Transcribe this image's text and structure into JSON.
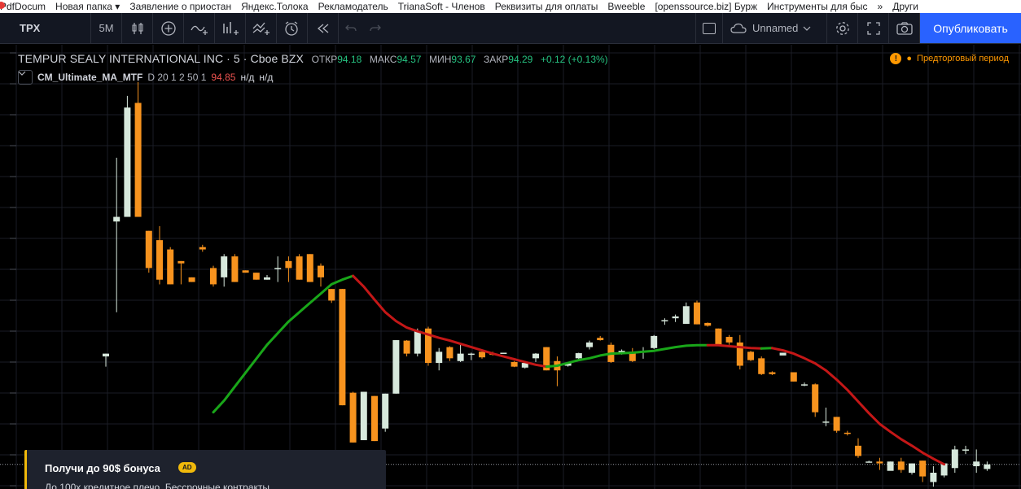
{
  "bookmarks": [
    "PdfDocum",
    "Новая папка ▾",
    "Заявление о приостан",
    "Яндекс.Толока",
    "Рекламодатель",
    "TrianaSoft - Членов",
    "Реквизиты для оплаты",
    "Bweeble",
    "[openssource.biz] Бурж",
    "Инструменты для быс",
    "»",
    "Други"
  ],
  "toolbar": {
    "symbol": "TPX",
    "interval": "5M",
    "icons": [
      "candles-icon",
      "plus-circle-icon",
      "indicator-icon",
      "templates-icon",
      "compare-icon",
      "alert-icon",
      "replay-icon",
      "undo-icon",
      "redo-icon"
    ],
    "layout_name": "Unnamed",
    "publish_label": "Опубликовать"
  },
  "legend": {
    "title": "TEMPUR SEALY INTERNATIONAL INC · 5 · Cboe BZX",
    "open_label": "ОТКР",
    "open": "94.18",
    "high_label": "МАКС",
    "high": "94.57",
    "low_label": "МИН",
    "low": "93.67",
    "close_label": "ЗАКР",
    "close": "94.29",
    "change": "+0.12 (+0.13%)"
  },
  "indicator": {
    "name": "CM_Ultimate_MA_MTF",
    "params": "D 20 1 2 50 1",
    "value": "94.85",
    "na1": "н/д",
    "na2": "н/д"
  },
  "market_status": {
    "label": "Предторговый период",
    "color": "#ff9800"
  },
  "promo": {
    "title": "Получи до 90$ бонуса",
    "badge": "AD",
    "body": "До 100х кредитное плечо. Бессрочные контракты"
  },
  "colors": {
    "up": "#d7e8dc",
    "down": "#f7931e",
    "ma_up": "#19a619",
    "ma_down": "#c41717",
    "accent": "#2962ff"
  },
  "chart_data": {
    "type": "candlestick",
    "interval": "5",
    "candles": [
      {
        "open": 94.4,
        "high": 94.46,
        "low": 94.18,
        "close": 94.46
      },
      {
        "open": 97.3,
        "high": 98.67,
        "low": 95.35,
        "close": 97.4
      },
      {
        "open": 97.4,
        "high": 100.0,
        "low": 97.4,
        "close": 99.75
      },
      {
        "open": 99.85,
        "high": 100.3,
        "low": 97.4,
        "close": 97.4
      },
      {
        "open": 97.1,
        "high": 97.1,
        "low": 96.2,
        "close": 96.3
      },
      {
        "open": 96.9,
        "high": 97.2,
        "low": 95.95,
        "close": 96.05
      },
      {
        "open": 96.7,
        "high": 96.75,
        "low": 95.95,
        "close": 95.95
      },
      {
        "open": 96.45,
        "high": 96.45,
        "low": 95.95,
        "close": 96.4
      },
      {
        "open": 96.1,
        "high": 96.1,
        "low": 96.0,
        "close": 96.0
      },
      {
        "open": 96.75,
        "high": 96.8,
        "low": 96.65,
        "close": 96.7
      },
      {
        "open": 96.3,
        "high": 96.35,
        "low": 95.9,
        "close": 95.95
      },
      {
        "open": 96.1,
        "high": 96.6,
        "low": 95.9,
        "close": 96.55
      },
      {
        "open": 96.55,
        "high": 96.6,
        "low": 96.0,
        "close": 96.0
      },
      {
        "open": 96.25,
        "high": 96.25,
        "low": 96.2,
        "close": 96.2
      },
      {
        "open": 96.2,
        "high": 96.2,
        "low": 96.05,
        "close": 96.05
      },
      {
        "open": 96.05,
        "high": 96.15,
        "low": 96.05,
        "close": 96.1
      },
      {
        "open": 96.3,
        "high": 96.55,
        "low": 96.0,
        "close": 96.3
      },
      {
        "open": 96.45,
        "high": 96.55,
        "low": 96.0,
        "close": 96.3
      },
      {
        "open": 96.55,
        "high": 96.6,
        "low": 96.05,
        "close": 96.05
      },
      {
        "open": 96.6,
        "high": 96.6,
        "low": 96.0,
        "close": 96.0
      },
      {
        "open": 96.35,
        "high": 96.4,
        "low": 95.9,
        "close": 96.1
      },
      {
        "open": 95.85,
        "high": 95.85,
        "low": 95.55,
        "close": 95.6
      },
      {
        "open": 95.85,
        "high": 95.85,
        "low": 93.35,
        "close": 93.35
      },
      {
        "open": 93.62,
        "high": 93.64,
        "low": 92.55,
        "close": 92.55
      },
      {
        "open": 92.6,
        "high": 93.64,
        "low": 92.6,
        "close": 93.64
      },
      {
        "open": 93.55,
        "high": 93.55,
        "low": 92.58,
        "close": 92.58
      },
      {
        "open": 92.85,
        "high": 93.6,
        "low": 92.78,
        "close": 93.6
      },
      {
        "open": 93.6,
        "high": 94.75,
        "low": 93.6,
        "close": 94.75
      },
      {
        "open": 94.74,
        "high": 94.75,
        "low": 94.4,
        "close": 94.46
      },
      {
        "open": 94.46,
        "high": 95.0,
        "low": 94.4,
        "close": 94.95
      },
      {
        "open": 95.0,
        "high": 95.04,
        "low": 94.2,
        "close": 94.26
      },
      {
        "open": 94.26,
        "high": 94.58,
        "low": 94.1,
        "close": 94.5
      },
      {
        "open": 94.6,
        "high": 94.62,
        "low": 94.3,
        "close": 94.36
      },
      {
        "open": 94.3,
        "high": 94.68,
        "low": 94.28,
        "close": 94.46
      },
      {
        "open": 94.44,
        "high": 94.48,
        "low": 94.32,
        "close": 94.46
      },
      {
        "open": 94.5,
        "high": 94.5,
        "low": 94.35,
        "close": 94.38
      },
      {
        "open": 94.46,
        "high": 94.5,
        "low": 94.42,
        "close": 94.45
      },
      {
        "open": 94.48,
        "high": 94.48,
        "low": 94.47,
        "close": 94.48
      },
      {
        "open": 94.28,
        "high": 94.3,
        "low": 94.17,
        "close": 94.18
      },
      {
        "open": 94.16,
        "high": 94.28,
        "low": 94.14,
        "close": 94.26
      },
      {
        "open": 94.36,
        "high": 94.47,
        "low": 94.28,
        "close": 94.46
      },
      {
        "open": 94.6,
        "high": 94.6,
        "low": 94.1,
        "close": 94.1
      },
      {
        "open": 94.3,
        "high": 94.4,
        "low": 93.76,
        "close": 94.1
      },
      {
        "open": 94.2,
        "high": 94.28,
        "low": 94.18,
        "close": 94.26
      },
      {
        "open": 94.36,
        "high": 94.48,
        "low": 94.3,
        "close": 94.47
      },
      {
        "open": 94.6,
        "high": 94.74,
        "low": 94.55,
        "close": 94.7
      },
      {
        "open": 94.8,
        "high": 94.84,
        "low": 94.74,
        "close": 94.75
      },
      {
        "open": 94.65,
        "high": 94.7,
        "low": 94.26,
        "close": 94.28
      },
      {
        "open": 94.46,
        "high": 94.55,
        "low": 94.44,
        "close": 94.52
      },
      {
        "open": 94.5,
        "high": 94.58,
        "low": 94.28,
        "close": 94.3
      },
      {
        "open": 94.5,
        "high": 94.6,
        "low": 94.35,
        "close": 94.52
      },
      {
        "open": 94.58,
        "high": 94.86,
        "low": 94.56,
        "close": 94.84
      },
      {
        "open": 95.18,
        "high": 95.22,
        "low": 95.08,
        "close": 95.18
      },
      {
        "open": 95.22,
        "high": 95.3,
        "low": 95.14,
        "close": 95.26
      },
      {
        "open": 95.1,
        "high": 95.56,
        "low": 95.1,
        "close": 95.48
      },
      {
        "open": 95.56,
        "high": 95.6,
        "low": 95.09,
        "close": 95.09
      },
      {
        "open": 95.12,
        "high": 95.13,
        "low": 95.04,
        "close": 95.06
      },
      {
        "open": 95.0,
        "high": 95.0,
        "low": 94.62,
        "close": 94.64
      },
      {
        "open": 94.82,
        "high": 94.86,
        "low": 94.65,
        "close": 94.7
      },
      {
        "open": 94.7,
        "high": 94.86,
        "low": 94.12,
        "close": 94.2
      },
      {
        "open": 94.5,
        "high": 94.52,
        "low": 94.3,
        "close": 94.32
      },
      {
        "open": 94.36,
        "high": 94.4,
        "low": 94.0,
        "close": 94.02
      },
      {
        "open": 94.06,
        "high": 94.08,
        "low": 94.0,
        "close": 94.02
      },
      {
        "open": 94.42,
        "high": 94.48,
        "low": 94.48,
        "close": 94.48
      },
      {
        "open": 94.06,
        "high": 94.06,
        "low": 93.86,
        "close": 93.86
      },
      {
        "open": 93.8,
        "high": 93.84,
        "low": 93.76,
        "close": 93.8
      },
      {
        "open": 93.8,
        "high": 93.82,
        "low": 93.1,
        "close": 93.2
      },
      {
        "open": 93.0,
        "high": 93.3,
        "low": 92.9,
        "close": 93.0
      },
      {
        "open": 93.1,
        "high": 93.1,
        "low": 92.76,
        "close": 92.8
      },
      {
        "open": 92.76,
        "high": 92.8,
        "low": 92.7,
        "close": 92.74
      },
      {
        "open": 92.48,
        "high": 92.64,
        "low": 92.22,
        "close": 92.26
      },
      {
        "open": 92.14,
        "high": 92.16,
        "low": 92.12,
        "close": 92.14
      },
      {
        "open": 92.14,
        "high": 92.22,
        "low": 91.96,
        "close": 92.1
      },
      {
        "open": 91.94,
        "high": 92.14,
        "low": 91.96,
        "close": 92.14
      },
      {
        "open": 92.14,
        "high": 92.22,
        "low": 91.9,
        "close": 91.96
      },
      {
        "open": 91.9,
        "high": 92.1,
        "low": 91.86,
        "close": 92.1
      },
      {
        "open": 92.16,
        "high": 92.16,
        "low": 91.7,
        "close": 91.82
      },
      {
        "open": 91.7,
        "high": 92.04,
        "low": 91.6,
        "close": 91.9
      },
      {
        "open": 91.84,
        "high": 92.1,
        "low": 91.8,
        "close": 92.1
      },
      {
        "open": 92.0,
        "high": 92.48,
        "low": 91.9,
        "close": 92.4
      },
      {
        "open": 92.4,
        "high": 92.48,
        "low": 92.3,
        "close": 92.4
      },
      {
        "open": 92.04,
        "high": 92.4,
        "low": 91.9,
        "close": 92.14
      },
      {
        "open": 91.98,
        "high": 92.14,
        "low": 91.94,
        "close": 92.08
      }
    ],
    "ma_series": [
      {
        "color": "green",
        "values": [
          93.2,
          93.45,
          93.75,
          94.05,
          94.35,
          94.65,
          94.9,
          95.15,
          95.35,
          95.55,
          95.75,
          95.95,
          96.05,
          96.13
        ]
      },
      {
        "color": "red",
        "values": [
          96.13,
          95.9,
          95.62,
          95.35,
          95.16,
          95.02,
          94.94,
          94.87,
          94.8,
          94.74,
          94.67,
          94.6,
          94.53,
          94.46,
          94.4,
          94.34,
          94.28,
          94.22,
          94.18
        ]
      },
      {
        "color": "green",
        "values": [
          94.18,
          94.2,
          94.26,
          94.32,
          94.36,
          94.42,
          94.46,
          94.47,
          94.48,
          94.5,
          94.52,
          94.56,
          94.6,
          94.63,
          94.64,
          94.64
        ]
      },
      {
        "color": "red",
        "values": [
          94.64,
          94.64,
          94.62,
          94.6,
          94.58,
          94.57
        ]
      },
      {
        "color": "green",
        "values": [
          94.57,
          94.58
        ]
      },
      {
        "color": "red",
        "values": [
          94.58,
          94.53,
          94.46,
          94.36,
          94.25,
          94.1,
          93.9,
          93.68,
          93.43,
          93.18,
          92.95,
          92.78,
          92.62,
          92.48,
          92.33,
          92.2,
          92.08
        ]
      }
    ],
    "ma_start_index": 10,
    "ylim": [
      91.55,
      101.1
    ],
    "grid": true
  }
}
